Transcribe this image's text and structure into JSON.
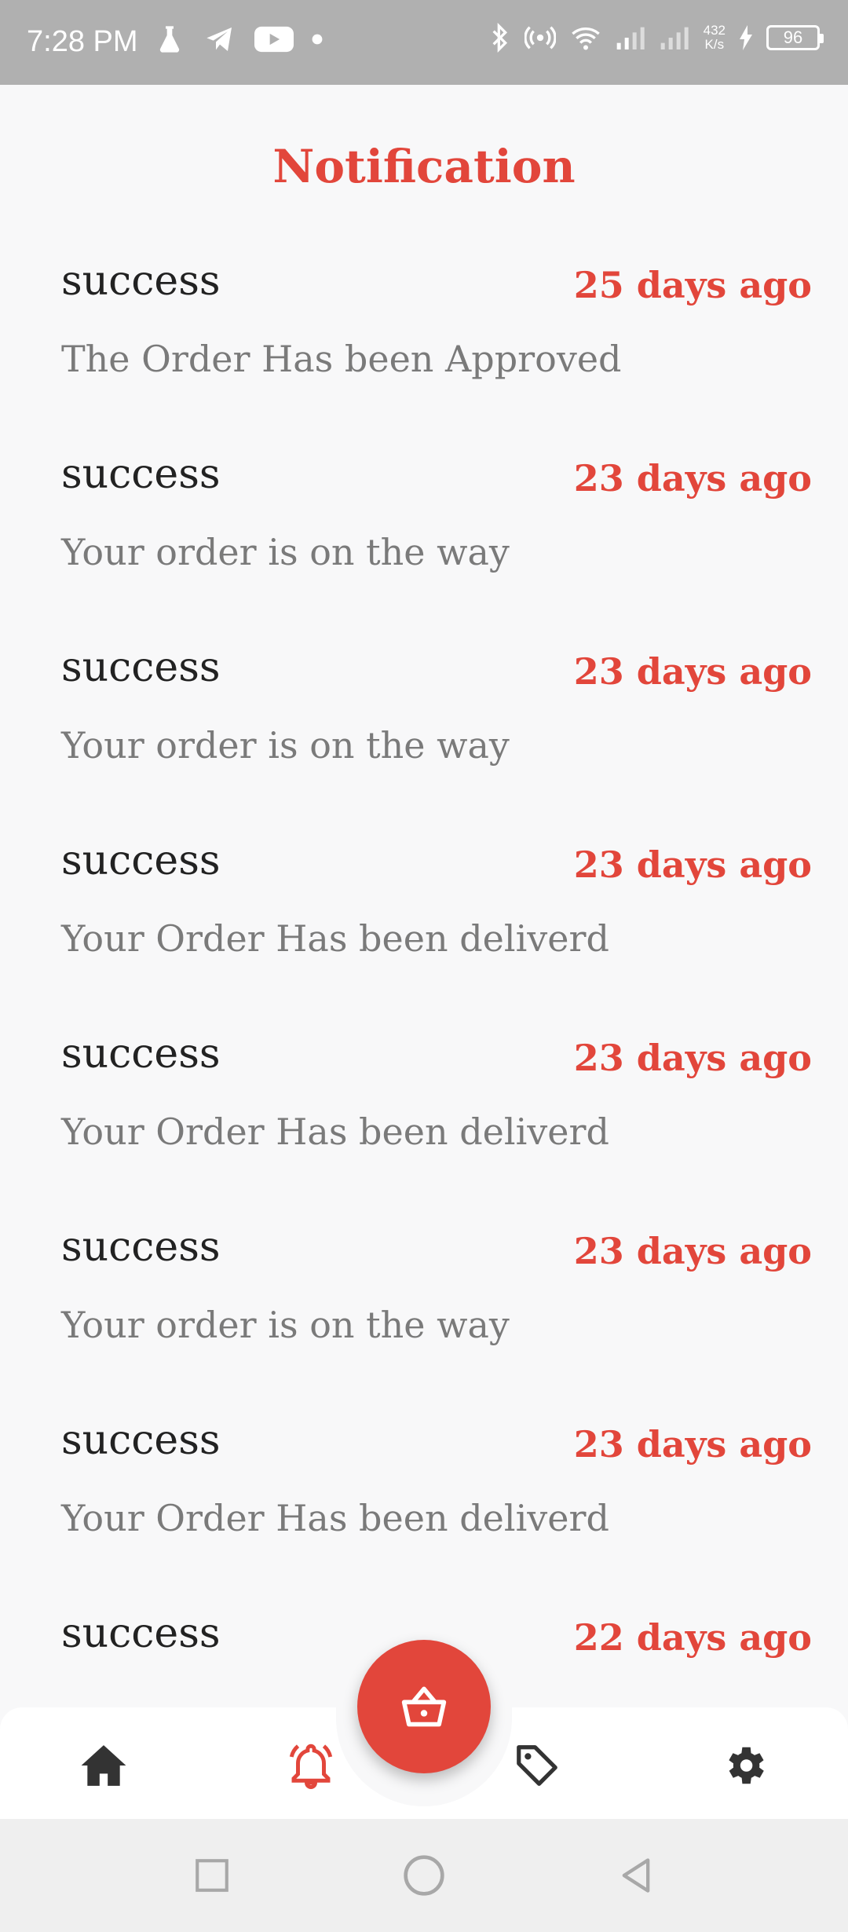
{
  "status_bar": {
    "time": "7:28 PM",
    "left_icons": [
      "flask-icon",
      "telegram-icon",
      "youtube-icon",
      "dot-icon"
    ],
    "right_icons": [
      "bluetooth-icon",
      "hotspot-icon",
      "wifi-icon",
      "signal-icon",
      "signal-icon"
    ],
    "net_speed_value": "432",
    "net_speed_unit": "K/s",
    "battery_level": "96"
  },
  "header": {
    "title": "Notification"
  },
  "notifications": [
    {
      "title": "success",
      "time": "25 days ago",
      "message": "The Order Has been Approved"
    },
    {
      "title": "success",
      "time": "23 days ago",
      "message": "Your order is on the way"
    },
    {
      "title": "success",
      "time": "23 days ago",
      "message": "Your order is on the way"
    },
    {
      "title": "success",
      "time": "23 days ago",
      "message": "Your Order Has been deliverd"
    },
    {
      "title": "success",
      "time": "23 days ago",
      "message": "Your Order Has been deliverd"
    },
    {
      "title": "success",
      "time": "23 days ago",
      "message": "Your order is on the way"
    },
    {
      "title": "success",
      "time": "23 days ago",
      "message": "Your Order Has been deliverd"
    },
    {
      "title": "success",
      "time": "22 days ago",
      "message": ""
    }
  ],
  "bottom_nav": {
    "items": [
      {
        "icon": "home-icon",
        "active": false
      },
      {
        "icon": "bell-icon",
        "active": true
      },
      {
        "icon": "tag-icon",
        "active": false
      },
      {
        "icon": "gear-icon",
        "active": false
      }
    ],
    "fab_icon": "basket-icon"
  },
  "system_nav": [
    "recent-apps-icon",
    "home-circle-icon",
    "back-icon"
  ],
  "colors": {
    "accent": "#e2463b",
    "title_text": "#222222",
    "message_text": "#7a7a7a",
    "icon_dark": "#333333",
    "background": "#f8f8f9"
  }
}
